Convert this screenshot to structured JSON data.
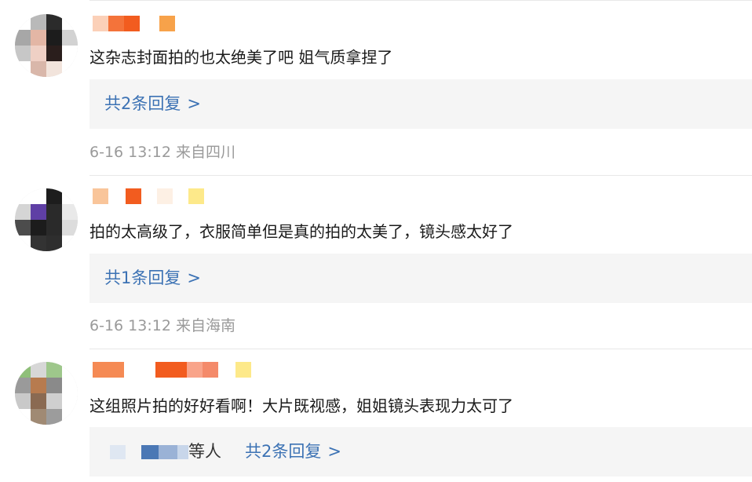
{
  "comments": [
    {
      "text": "这杂志封面拍的也太绝美了吧  姐气质拿捏了",
      "reply_text": "共2条回复",
      "reply_chevron": ">",
      "timestamp": "6-16 13:12",
      "location": "来自四川"
    },
    {
      "text": "拍的太高级了，衣服简单但是真的拍的太美了，镜头感太好了",
      "reply_text": "共1条回复",
      "reply_chevron": ">",
      "timestamp": "6-16 13:12",
      "location": "来自海南"
    },
    {
      "text": "这组照片拍的好好看啊！大片既视感，姐姐镜头表现力太可了",
      "replier_suffix": "等人",
      "reply_text": "共2条回复",
      "reply_chevron": ">"
    }
  ],
  "colors": {
    "link": "#3c72b4",
    "meta": "#9a9a9a",
    "text": "#1a1a1a",
    "reply_bg": "#f5f5f5",
    "username_blur": [
      "#f25c1f",
      "#f7a24a",
      "#f9c59a",
      "#fde98a"
    ]
  }
}
